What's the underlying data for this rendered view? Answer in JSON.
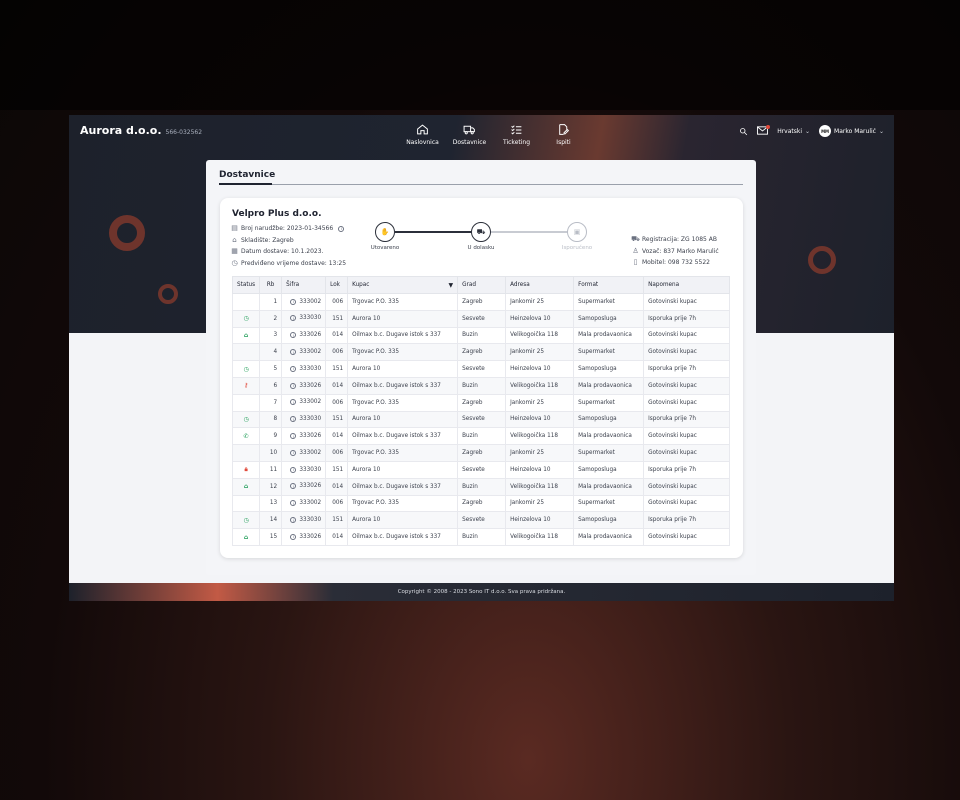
{
  "brand": {
    "name": "Aurora d.o.o.",
    "id": "566-032562"
  },
  "nav": [
    {
      "label": "Naslovnica",
      "icon": "home-icon"
    },
    {
      "label": "Dostavnice",
      "icon": "truck-icon"
    },
    {
      "label": "Ticketing",
      "icon": "checklist-icon"
    },
    {
      "label": "Ispiti",
      "icon": "edit-document-icon"
    }
  ],
  "header": {
    "language": "Hrvatski",
    "user_initials": "MM",
    "user_name": "Marko Marulić"
  },
  "page": {
    "title": "Dostavnice"
  },
  "order": {
    "company": "Velpro Plus d.o.o.",
    "order_no": "Broj narudžbe: 2023-01-34566",
    "warehouse": "Skladište: Zagreb",
    "delivery_date": "Datum dostave: 10.1.2023.",
    "eta": "Predviđeno vrijeme dostave: 13:25",
    "registration": "Registracija: ZG 1085 AB",
    "driver": "Vozač: 837 Marko Marulić",
    "mobile": "Mobitel: 098 732 5522"
  },
  "progress": {
    "steps": [
      {
        "label": "Utovareno",
        "state": "done"
      },
      {
        "label": "U dolasku",
        "state": "current"
      },
      {
        "label": "Isporučeno",
        "state": "pending"
      }
    ]
  },
  "table": {
    "headers": [
      "Status",
      "Rb",
      "Šifra",
      "Lok",
      "Kupac",
      "Grad",
      "Adresa",
      "Format",
      "Napomena"
    ],
    "rows": [
      {
        "status": "",
        "rb": "1",
        "sifra": "333002",
        "lok": "006",
        "kupac": "Trgovac P.O. 335",
        "grad": "Zagreb",
        "adresa": "Jankomir 25",
        "format": "Supermarket",
        "napomena": "Gotovinski kupac"
      },
      {
        "status": "clock",
        "rb": "2",
        "sifra": "333030",
        "lok": "151",
        "kupac": "Aurora 10",
        "grad": "Sesvete",
        "adresa": "Heinzelova 10",
        "format": "Samoposluga",
        "napomena": "Isporuka prije 7h"
      },
      {
        "status": "home",
        "rb": "3",
        "sifra": "333026",
        "lok": "014",
        "kupac": "Oilmax b.c. Dugave istok s 337",
        "grad": "Buzin",
        "adresa": "Velikogoička 118",
        "format": "Mala prodavaonica",
        "napomena": "Gotovinski kupac"
      },
      {
        "status": "",
        "rb": "4",
        "sifra": "333002",
        "lok": "006",
        "kupac": "Trgovac P.O. 335",
        "grad": "Zagreb",
        "adresa": "Jankomir 25",
        "format": "Supermarket",
        "napomena": "Gotovinski kupac"
      },
      {
        "status": "clock",
        "rb": "5",
        "sifra": "333030",
        "lok": "151",
        "kupac": "Aurora 10",
        "grad": "Sesvete",
        "adresa": "Heinzelova 10",
        "format": "Samoposluga",
        "napomena": "Isporuka prije 7h"
      },
      {
        "status": "key",
        "rb": "6",
        "sifra": "333026",
        "lok": "014",
        "kupac": "Oilmax b.c. Dugave istok s 337",
        "grad": "Buzin",
        "adresa": "Velikogoička 118",
        "format": "Mala prodavaonica",
        "napomena": "Gotovinski kupac"
      },
      {
        "status": "",
        "rb": "7",
        "sifra": "333002",
        "lok": "006",
        "kupac": "Trgovac P.O. 335",
        "grad": "Zagreb",
        "adresa": "Jankomir 25",
        "format": "Supermarket",
        "napomena": "Gotovinski kupac"
      },
      {
        "status": "clock",
        "rb": "8",
        "sifra": "333030",
        "lok": "151",
        "kupac": "Aurora 10",
        "grad": "Sesvete",
        "adresa": "Heinzelova 10",
        "format": "Samoposluga",
        "napomena": "Isporuka prije 7h"
      },
      {
        "status": "phone",
        "rb": "9",
        "sifra": "333026",
        "lok": "014",
        "kupac": "Oilmax b.c. Dugave istok s 337",
        "grad": "Buzin",
        "adresa": "Velikogoička 118",
        "format": "Mala prodavaonica",
        "napomena": "Gotovinski kupac"
      },
      {
        "status": "",
        "rb": "10",
        "sifra": "333002",
        "lok": "006",
        "kupac": "Trgovac P.O. 335",
        "grad": "Zagreb",
        "adresa": "Jankomir 25",
        "format": "Supermarket",
        "napomena": "Gotovinski kupac"
      },
      {
        "status": "lock",
        "rb": "11",
        "sifra": "333030",
        "lok": "151",
        "kupac": "Aurora 10",
        "grad": "Sesvete",
        "adresa": "Heinzelova 10",
        "format": "Samoposluga",
        "napomena": "Isporuka prije 7h"
      },
      {
        "status": "home",
        "rb": "12",
        "sifra": "333026",
        "lok": "014",
        "kupac": "Oilmax b.c. Dugave istok s 337",
        "grad": "Buzin",
        "adresa": "Velikogoička 118",
        "format": "Mala prodavaonica",
        "napomena": "Gotovinski kupac"
      },
      {
        "status": "",
        "rb": "13",
        "sifra": "333002",
        "lok": "006",
        "kupac": "Trgovac P.O. 335",
        "grad": "Zagreb",
        "adresa": "Jankomir 25",
        "format": "Supermarket",
        "napomena": "Gotovinski kupac"
      },
      {
        "status": "clock",
        "rb": "14",
        "sifra": "333030",
        "lok": "151",
        "kupac": "Aurora 10",
        "grad": "Sesvete",
        "adresa": "Heinzelova 10",
        "format": "Samoposluga",
        "napomena": "Isporuka prije 7h"
      },
      {
        "status": "home",
        "rb": "15",
        "sifra": "333026",
        "lok": "014",
        "kupac": "Oilmax b.c. Dugave istok s 337",
        "grad": "Buzin",
        "adresa": "Velikogoička 118",
        "format": "Mala prodavaonica",
        "napomena": "Gotovinski kupac"
      }
    ]
  },
  "footer": {
    "text": "Copyright © 2008 - 2023 Sono IT d.o.o. Sva prava pridržana."
  },
  "colors": {
    "dark": "#1d212b",
    "accent": "#c25a45",
    "status_green": "#1f9d57",
    "status_red": "#e14a3b"
  }
}
